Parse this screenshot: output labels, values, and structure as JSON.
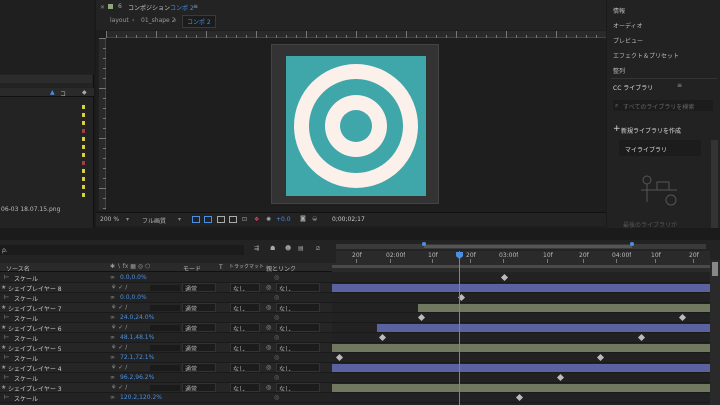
{
  "project": {
    "date_label": "06-03 18.07.15.png",
    "col_header": "コ"
  },
  "comp": {
    "title": "コンポジション",
    "comp_name": "コンポ 2",
    "layout_label": "layout",
    "breadcrumb_1": "01_shape 2",
    "breadcrumb_2": "コンポ 2",
    "zoom": "200 %",
    "quality": "フル画質",
    "exposure": "+0.0",
    "timecode": "0;00;02;17",
    "colors": {
      "teal": "#3fa6aa",
      "cream": "#fbf0ea"
    }
  },
  "right_panel": {
    "items": [
      "情報",
      "オーディオ",
      "プレビュー",
      "エフェクト＆プリセット",
      "整列"
    ],
    "libraries_title": "CC ライブラリ",
    "search_placeholder": "すべてのライブラリを検索",
    "new_library": "新規ライブラリを作成",
    "my_library": "マイライブラリ",
    "empty_text": "最後のライブラリが"
  },
  "timeline": {
    "search_label": "ρ.",
    "col_source": "ソース名",
    "col_mode": "モード",
    "col_t": "T",
    "col_trackmatte": "トラックマット",
    "col_parent": "親とリンク",
    "ruler": [
      "20f",
      "02:00f",
      "10f",
      "20f",
      "03:00f",
      "10f",
      "20f",
      "04:00f",
      "10f",
      "20f"
    ],
    "mode_normal": "通常",
    "none": "なし",
    "rows": [
      {
        "type": "scale",
        "name": "スケール",
        "value": "0.0,0.0%"
      },
      {
        "type": "layer",
        "name": "シェイプレイヤー 8"
      },
      {
        "type": "scale",
        "name": "スケール",
        "value": "0.0,0.0%"
      },
      {
        "type": "layer",
        "name": "シェイプレイヤー 7"
      },
      {
        "type": "scale",
        "name": "スケール",
        "value": "24.0,24.0%"
      },
      {
        "type": "layer",
        "name": "シェイプレイヤー 6"
      },
      {
        "type": "scale",
        "name": "スケール",
        "value": "48.1,48.1%"
      },
      {
        "type": "layer",
        "name": "シェイプレイヤー 5"
      },
      {
        "type": "scale",
        "name": "スケール",
        "value": "72.1,72.1%"
      },
      {
        "type": "layer",
        "name": "シェイプレイヤー 4"
      },
      {
        "type": "scale",
        "name": "スケール",
        "value": "96.2,96.2%"
      },
      {
        "type": "layer",
        "name": "シェイプレイヤー 3"
      },
      {
        "type": "scale",
        "name": "スケール",
        "value": "120.2,120.2%"
      }
    ]
  }
}
